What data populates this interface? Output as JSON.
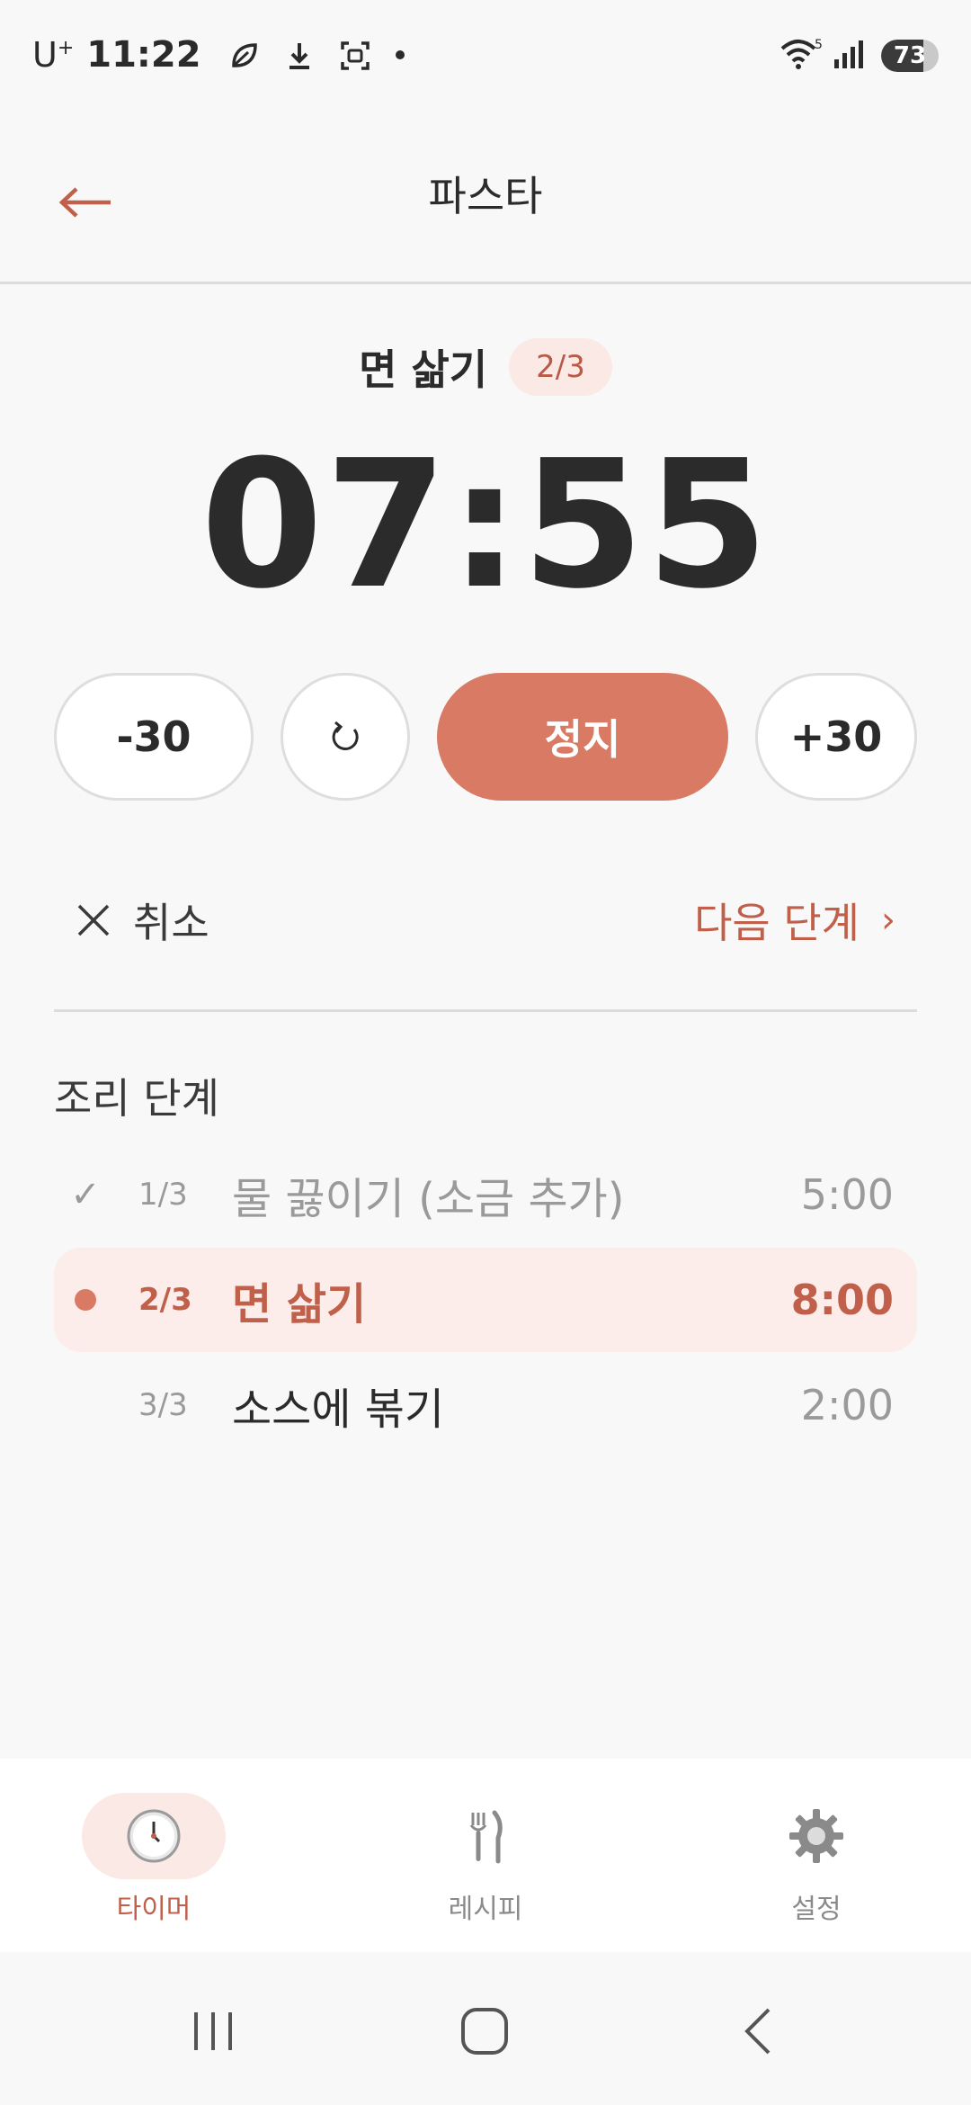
{
  "status_bar": {
    "carrier": "U",
    "carrier_sup": "+",
    "time": "11:22",
    "battery": "73",
    "battery_level": 0.73,
    "icons": [
      "leaf-icon",
      "download-icon",
      "screenshot-icon",
      "dot-icon",
      "wifi-icon",
      "signal-icon",
      "battery-icon"
    ]
  },
  "app_bar": {
    "back_icon": "arrow-left-icon",
    "title": "파스타"
  },
  "current_step": {
    "name": "면 삶기",
    "badge": "2/3",
    "timer": "07:55"
  },
  "controls": {
    "minus": "-30",
    "reset_icon": "reset-icon",
    "stop": "정지",
    "plus": "+30"
  },
  "actions": {
    "cancel": "취소",
    "next": "다음 단계",
    "next_chevron": "›"
  },
  "steps_section": {
    "title": "조리 단계",
    "steps": [
      {
        "num": "1/3",
        "label": "물 끓이기 (소금 추가)",
        "duration": "5:00",
        "state": "done",
        "marker": "✓"
      },
      {
        "num": "2/3",
        "label": "면 삶기",
        "duration": "8:00",
        "state": "active",
        "marker": ""
      },
      {
        "num": "3/3",
        "label": "소스에 볶기",
        "duration": "2:00",
        "state": "pending",
        "marker": ""
      }
    ]
  },
  "bottom_nav": {
    "items": [
      {
        "label": "타이머",
        "icon": "clock-icon",
        "active": true
      },
      {
        "label": "레시피",
        "icon": "fork-knife-icon",
        "active": false
      },
      {
        "label": "설정",
        "icon": "gear-icon",
        "active": false
      }
    ]
  },
  "system_nav": [
    "recent-apps-icon",
    "home-icon",
    "back-icon"
  ],
  "colors": {
    "accent": "#d97a64",
    "accent_text": "#c0604a",
    "accent_soft": "#fbe9e6",
    "background": "#f8f8f8"
  }
}
